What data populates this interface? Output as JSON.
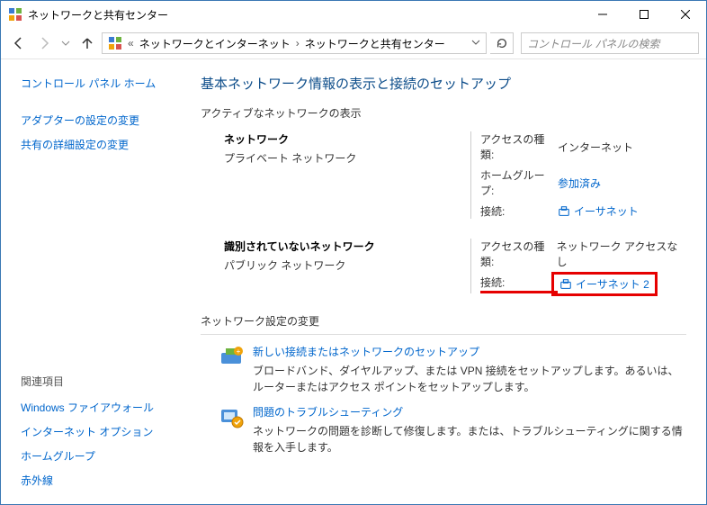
{
  "window": {
    "title": "ネットワークと共有センター"
  },
  "breadcrumb": {
    "seg1": "ネットワークとインターネット",
    "seg2": "ネットワークと共有センター"
  },
  "search": {
    "placeholder": "コントロール パネルの検索"
  },
  "sidebar": {
    "home": "コントロール パネル ホーム",
    "adapter": "アダプターの設定の変更",
    "sharing": "共有の詳細設定の変更"
  },
  "related": {
    "heading": "関連項目",
    "firewall": "Windows ファイアウォール",
    "inetopt": "インターネット オプション",
    "homegroup": "ホームグループ",
    "infrared": "赤外線"
  },
  "page": {
    "title": "基本ネットワーク情報の表示と接続のセットアップ",
    "active_heading": "アクティブなネットワークの表示"
  },
  "labels": {
    "access_type": "アクセスの種類:",
    "homegroup": "ホームグループ:",
    "connection": "接続:"
  },
  "net1": {
    "name": "ネットワーク",
    "type": "プライベート ネットワーク",
    "access": "インターネット",
    "homegroup_status": "参加済み",
    "conn_name": "イーサネット"
  },
  "net2": {
    "name": "識別されていないネットワーク",
    "type": "パブリック ネットワーク",
    "access": "ネットワーク アクセスなし",
    "conn_name": "イーサネット 2"
  },
  "settings": {
    "heading": "ネットワーク設定の変更",
    "opt1_title": "新しい接続またはネットワークのセットアップ",
    "opt1_desc": "ブロードバンド、ダイヤルアップ、または VPN 接続をセットアップします。あるいは、ルーターまたはアクセス ポイントをセットアップします。",
    "opt2_title": "問題のトラブルシューティング",
    "opt2_desc": "ネットワークの問題を診断して修復します。または、トラブルシューティングに関する情報を入手します。"
  }
}
